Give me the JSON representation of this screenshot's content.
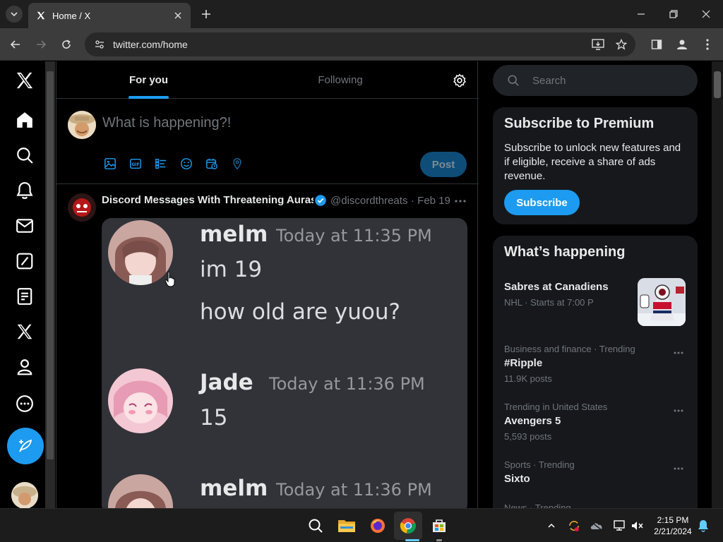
{
  "browser": {
    "tab_title": "Home / X",
    "url": "twitter.com/home"
  },
  "x_nav": {
    "items": [
      "x-logo-icon",
      "home-icon",
      "explore-icon",
      "notifications-icon",
      "messages-icon",
      "grok-icon",
      "lists-icon",
      "premium-icon",
      "profile-icon",
      "more-icon",
      "compose-icon"
    ]
  },
  "feed": {
    "tabs": [
      {
        "label": "For you",
        "active": true
      },
      {
        "label": "Following",
        "active": false
      }
    ],
    "composer": {
      "placeholder": "What is happening?!",
      "post_label": "Post"
    },
    "tweet": {
      "author_name": "Discord Messages With Threatening Auras",
      "handle": "@discordthreats",
      "date": "· Feb 19",
      "media_messages": [
        {
          "user": "melm",
          "time": "Today at 11:35 PM",
          "lines": [
            "im 19",
            "how old are yuou?"
          ]
        },
        {
          "user": "Jade",
          "time": "Today at 11:36 PM",
          "lines": [
            "15"
          ]
        },
        {
          "user": "melm",
          "time": "Today at 11:36 PM",
          "lines": []
        }
      ]
    }
  },
  "sidebar": {
    "search_placeholder": "Search",
    "premium": {
      "title": "Subscribe to Premium",
      "body": "Subscribe to unlock new features and if eligible, receive a share of ads revenue.",
      "button": "Subscribe"
    },
    "happening": {
      "title": "What’s happening",
      "trends": [
        {
          "meta": "",
          "title": "Sabres at Canadiens",
          "sub": "NHL · Starts at 7:00 P"
        },
        {
          "meta": "Business and finance · Trending",
          "title": "#Ripple",
          "sub": "11.9K posts"
        },
        {
          "meta": "Trending in United States",
          "title": "Avengers 5",
          "sub": "5,593 posts"
        },
        {
          "meta": "Sports · Trending",
          "title": "Sixto",
          "sub": ""
        },
        {
          "meta": "News · Trending",
          "title": "",
          "sub": ""
        }
      ]
    }
  },
  "taskbar": {
    "time": "2:15 PM",
    "date": "2/21/2024"
  },
  "colors": {
    "accent": "#1d9bf0",
    "background": "#000000",
    "card": "#16181c",
    "muted": "#71767b"
  }
}
